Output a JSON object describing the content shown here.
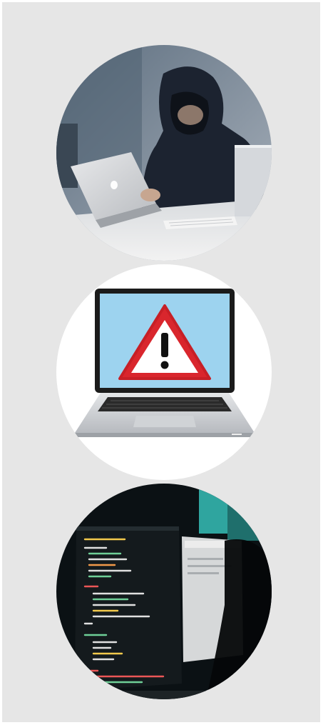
{
  "page": {
    "background_color": "#e6e6e6",
    "images": [
      {
        "icon": "hooded-hacker-laptop-icon",
        "alt": ""
      },
      {
        "icon": "laptop-warning-icon",
        "alt": ""
      },
      {
        "icon": "code-screen-icon",
        "alt": ""
      }
    ]
  }
}
